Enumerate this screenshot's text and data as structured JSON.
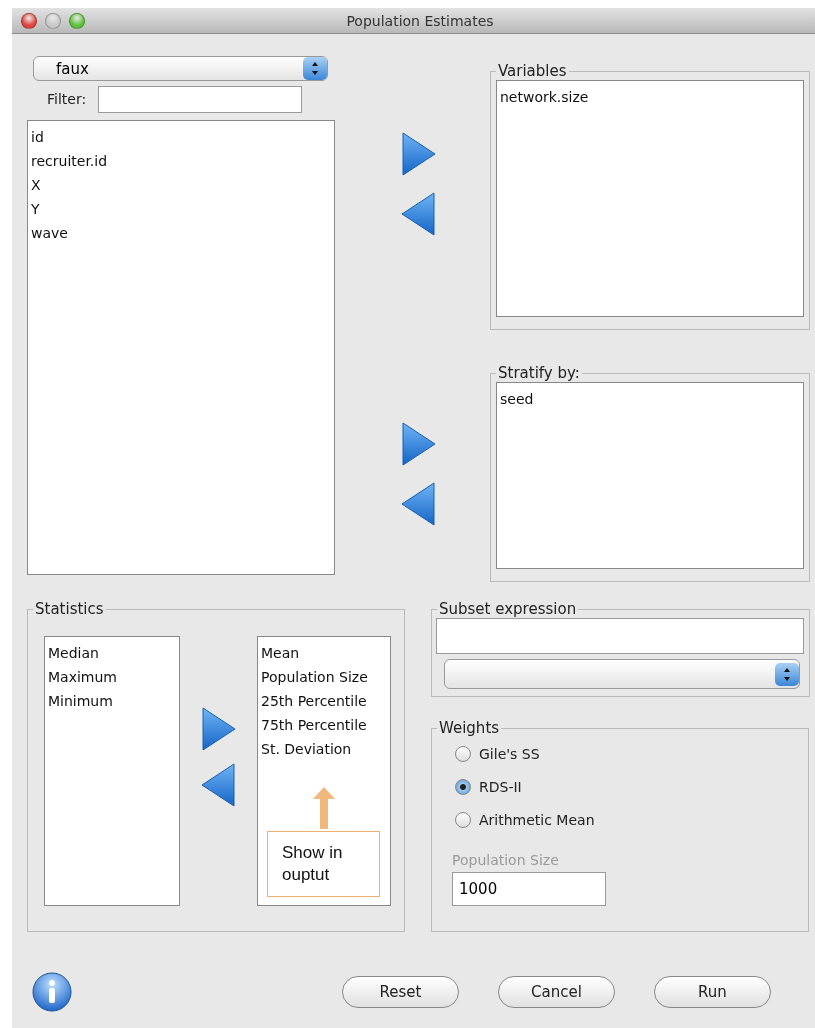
{
  "window": {
    "title": "Population Estimates"
  },
  "dataset": {
    "value": "faux"
  },
  "filter": {
    "label": "Filter:"
  },
  "source_list": [
    "id",
    "recruiter.id",
    "X",
    "Y",
    "wave"
  ],
  "variables": {
    "title": "Variables",
    "items": [
      "network.size"
    ]
  },
  "stratify": {
    "title": "Stratify by:",
    "items": [
      "seed"
    ]
  },
  "statistics": {
    "title": "Statistics",
    "available": [
      "Median",
      "Maximum",
      "Minimum"
    ],
    "selected": [
      "Mean",
      "Population Size",
      "25th Percentile",
      "75th Percentile",
      "St. Deviation"
    ]
  },
  "annotation": {
    "text": "Show in ouptut"
  },
  "subset": {
    "title": "Subset expression"
  },
  "weights": {
    "title": "Weights",
    "options": [
      {
        "label": "Gile's SS",
        "selected": false
      },
      {
        "label": "RDS-II",
        "selected": true
      },
      {
        "label": "Arithmetic Mean",
        "selected": false
      }
    ],
    "population_size": {
      "label": "Population Size",
      "value": "1000",
      "disabled": true
    }
  },
  "buttons": [
    "Reset",
    "Cancel",
    "Run"
  ]
}
